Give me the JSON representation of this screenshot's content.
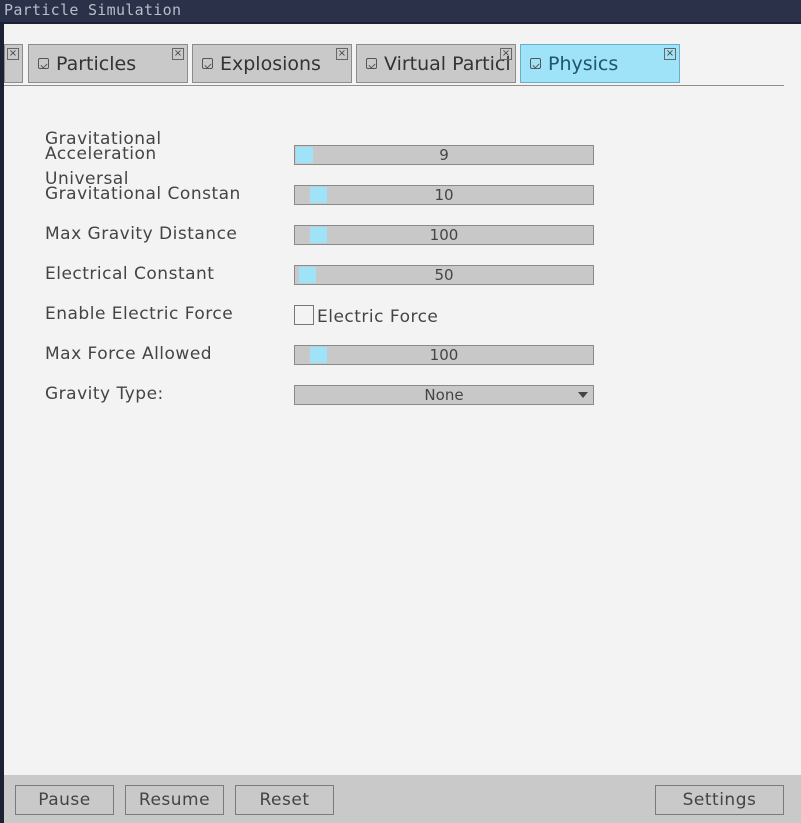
{
  "app": {
    "title": "Particle Simulation"
  },
  "tabs": [
    {
      "label": ""
    },
    {
      "label": "Particles"
    },
    {
      "label": "Explosions"
    },
    {
      "label": "Virtual Particles"
    },
    {
      "label": "Physics",
      "active": true
    }
  ],
  "tab_close_glyph": "×",
  "settings": {
    "gravitational_acceleration": {
      "label_line1": "Gravitational",
      "label_line2": "Acceleration",
      "value": "9",
      "fill_fraction": 0.0
    },
    "universal_gravitational_constant": {
      "label_line1": "Universal",
      "label_line2": "Gravitational Constan",
      "value": "10",
      "fill_fraction": 0.05
    },
    "max_gravity_distance": {
      "label": "Max Gravity Distance",
      "value": "100",
      "fill_fraction": 0.05
    },
    "electrical_constant": {
      "label": "Electrical Constant",
      "value": "50",
      "fill_fraction": 0.01
    },
    "enable_electric_force": {
      "label": "Enable Electric Force",
      "checkbox_label": "Electric Force",
      "checked": false
    },
    "max_force_allowed": {
      "label": "Max Force Allowed",
      "value": "100",
      "fill_fraction": 0.05
    },
    "gravity_type": {
      "label": "Gravity Type:",
      "value": "None"
    }
  },
  "buttons": {
    "pause": "Pause",
    "resume": "Resume",
    "reset": "Reset",
    "settings": "Settings"
  },
  "colors": {
    "accent": "#9ee3f8",
    "panel_bg": "#f3f3f3",
    "control_bg": "#c8c8c8",
    "titlebar_bg": "#2a3148"
  },
  "icons": {
    "tab_icon": "image-icon",
    "close_icon": "close-icon",
    "dropdown_arrow": "chevron-down-icon"
  }
}
